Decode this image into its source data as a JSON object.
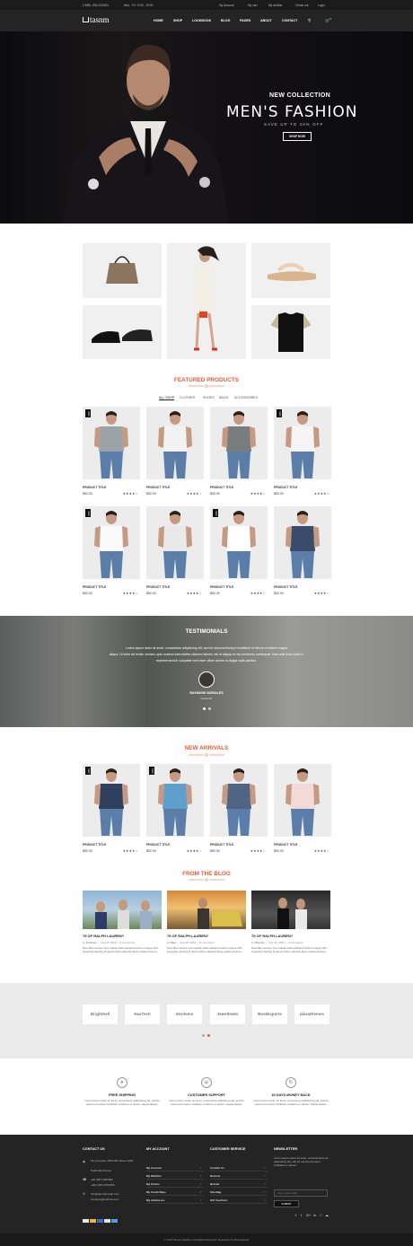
{
  "topbar": {
    "phone": "(+880) 1910-000251",
    "hours": "Mon - Fri : 9:00 - 19:00",
    "my_account": "My Account",
    "my_cart": "My cart",
    "my_wishlist": "My wishlist",
    "check_out": "Check out",
    "login": "Login"
  },
  "nav": {
    "logo": "tasnm",
    "items": [
      "HOME",
      "SHOP",
      "LOOKBOOK",
      "BLOG",
      "PAGES",
      "ABOUT",
      "CONTACT"
    ],
    "cart_count": "0"
  },
  "hero": {
    "subtitle": "NEW COLLECTION",
    "title": "MEN'S FASHION",
    "tagline": "SAVE UP TO 40% OFF",
    "button": "SHOP NOW"
  },
  "featured": {
    "title": "FEATURED PRODUCTS",
    "tabs": [
      "ALL SHOP",
      "CLOTHER",
      "SHOES",
      "BAGS",
      "ACCESSORIES"
    ]
  },
  "products": [
    {
      "title": "PRODUCT TITLE",
      "price": "$52.00",
      "badge": "NEW",
      "rating": 4
    },
    {
      "title": "PRODUCT TITLE",
      "price": "$52.00",
      "badge": "",
      "rating": 4
    },
    {
      "title": "PRODUCT TITLE",
      "price": "$52.00",
      "badge": "",
      "rating": 4
    },
    {
      "title": "PRODUCT TITLE",
      "price": "$52.00",
      "badge": "NEW",
      "rating": 4
    },
    {
      "title": "PRODUCT TITLE",
      "price": "$52.00",
      "badge": "NEW",
      "rating": 4
    },
    {
      "title": "PRODUCT TITLE",
      "price": "$52.00",
      "badge": "",
      "rating": 4
    },
    {
      "title": "PRODUCT TITLE",
      "price": "$52.00",
      "badge": "NEW",
      "rating": 4
    },
    {
      "title": "PRODUCT TITLE",
      "price": "$52.00",
      "badge": "",
      "rating": 4
    }
  ],
  "testimonials": {
    "title": "TESTIMONIALS",
    "lines": [
      "Lorem ipsum dolor sit amet, consectetur adipisicing elit, sed do eiusmod tempor incididunt ut labore et dolore magna",
      "aliqua. Ut enim ad minim veniam, quis nostrud exercitation ullamco laboris nisi ut aliquip ex ea commodo consequat. Duis aute irure dolor in",
      "reprehenderit in voluptate velit esse cillum dolore eu fugiat nulla pariatur."
    ],
    "name": "RAYMOND MORALES",
    "role": "Customer"
  },
  "new_arrivals": {
    "title": "NEW ARRIVALS"
  },
  "arrivals": [
    {
      "title": "PRODUCT TITLE",
      "price": "$52.00",
      "badge": "NEW",
      "rating": 4
    },
    {
      "title": "PRODUCT TITLE",
      "price": "$52.00",
      "badge": "NEW",
      "rating": 4
    },
    {
      "title": "PRODUCT TITLE",
      "price": "$52.00",
      "badge": "",
      "rating": 4
    },
    {
      "title": "PRODUCT TITLE",
      "price": "$52.00",
      "badge": "",
      "rating": 4
    }
  ],
  "blog": {
    "title": "FROM THE BLOG",
    "posts": [
      {
        "title": "75 OF RALPH LAUREN?",
        "author": "Fashion",
        "date": "July 18, 2016",
        "comments": "0 comments",
        "excerpt": "Nam liber tempor cum soluta nobis eleifend option congue nihil imperdiet doming id quod mazim placerat facer possim assum..."
      },
      {
        "title": "75 OF RALPH LAUREN?",
        "author": "Men",
        "date": "July 18, 2016",
        "comments": "0 comments",
        "excerpt": "Nam liber tempor cum soluta nobis eleifend option congue nihil imperdiet doming id quod mazim placerat facer possim assum..."
      },
      {
        "title": "75 OF RALPH LAUREN?",
        "author": "Woman",
        "date": "July 18, 2016",
        "comments": "0 comments",
        "excerpt": "Nam liber tempor cum soluta nobis eleifend option congue nihil imperdiet doming id quod mazim placerat facer possim assum..."
      }
    ]
  },
  "brands": [
    "BrightSell",
    "HasTech",
    "devitems",
    "Jewelteaks",
    "BootExperts",
    "plazathemes"
  ],
  "features": [
    {
      "title": "FREE SHIPPING",
      "text": "Lorem ipsum dolor sit amet, consectetur adipisicing elit, sed do eiusmod tempor incididunt ut labore et dolore magna aliqua."
    },
    {
      "title": "CUSTOMER SUPPORT",
      "text": "Lorem ipsum dolor sit amet, consectetur adipisicing elit, sed do eiusmod tempor incididunt ut labore et dolore magna aliqua."
    },
    {
      "title": "15 DAYS MONEY BACK",
      "text": "Lorem ipsum dolor sit amet, consectetur adipisicing elit, sed do eiusmod tempor incididunt ut labore et dolore magna aliqua."
    }
  ],
  "footer": {
    "contact_title": "CONTACT US",
    "address1": "My Company, 85 Puffin Street 1040",
    "address2": "Puffinville France",
    "phone1": "+20 (387) 658-852",
    "phone2": "+202 (387) 658-556",
    "email1": "info@demodomain.com",
    "email2": "company@outlook.com",
    "account_title": "MY ACCOUNT",
    "account_links": [
      "My Account",
      "My Wishlist",
      "My Orders",
      "My Credit Slips",
      "My Addresses"
    ],
    "service_title": "CUSTOMER SERVICE",
    "service_links": [
      "Contact Us",
      "Returns",
      "Brands",
      "Site Map",
      "Gift Vouchers"
    ],
    "newsletter_title": "NEWSLETTER",
    "newsletter_text": "Lorem ipsum dolor sit amet, consectetuere do adipisicing elit, sed do eiusmod tempor incididunt ut labore",
    "newsletter_placeholder": "enter your email",
    "submit": "SUBMIT",
    "copyright": "© 2016 Tasnm Fashion. All Rights Reserved. Developer by Bootexperts"
  },
  "colors": {
    "accent": "#e25c37",
    "dark": "#242424"
  }
}
